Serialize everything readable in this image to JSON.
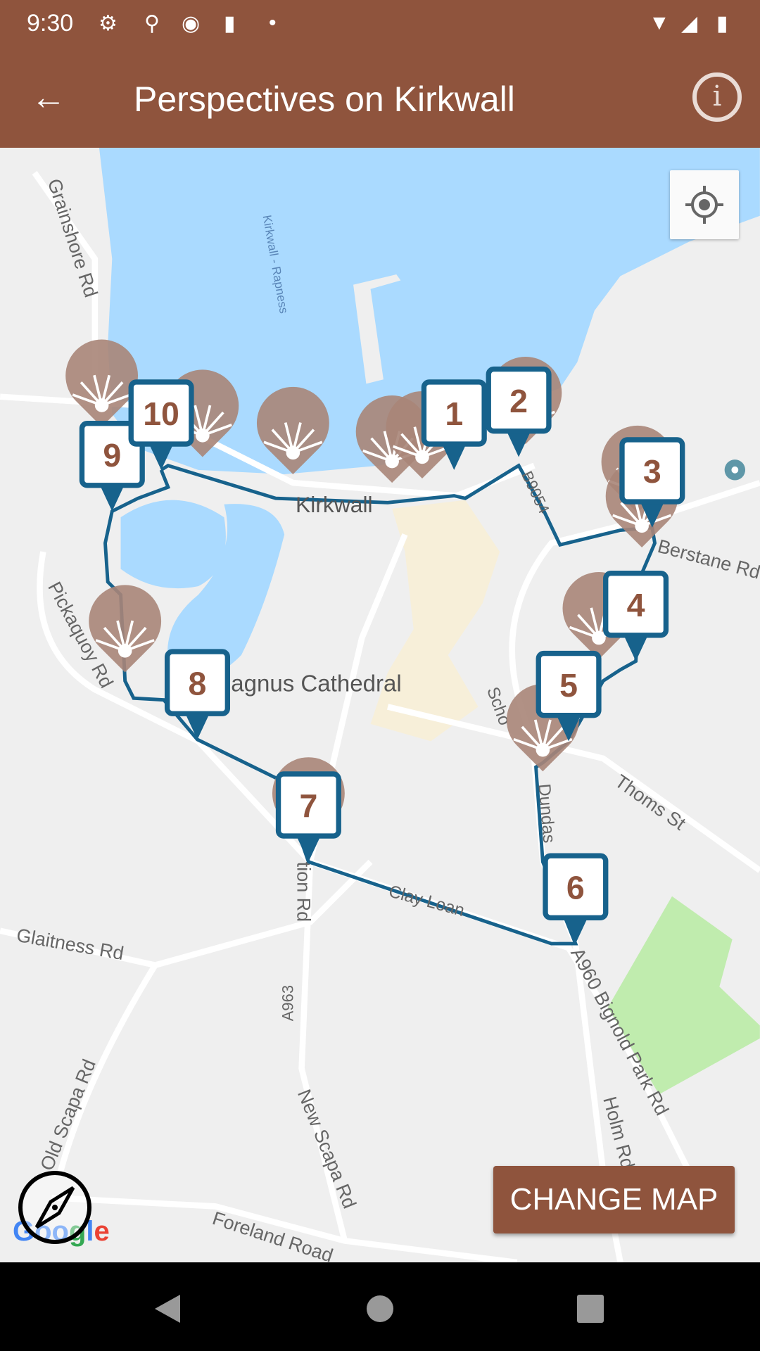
{
  "status_bar": {
    "time": "9:30",
    "icons": [
      "gear-icon",
      "keyhole-icon",
      "location-pin-icon",
      "sd-card-icon",
      "dot-icon",
      "wifi-icon",
      "signal-icon",
      "battery-charging-icon"
    ]
  },
  "app_bar": {
    "title": "Perspectives on Kirkwall",
    "back_icon": "arrow-left-icon",
    "info_icon": "info-icon"
  },
  "map": {
    "labels": {
      "grainshore": "Grainshore Rd",
      "ferry": "Kirkwall - Rapness",
      "kirkwall": "Kirkwall",
      "b9054": "B9054",
      "berstane": "Berstane Rd",
      "pickaquoy": "Pickaquoy Rd",
      "cathedral": "agnus Cathedral",
      "school": "Scho",
      "thoms": "Thoms St",
      "dundas": "Dundas",
      "clay": "Clay Loan",
      "glaitness": "Glaitness Rd",
      "a963": "A963",
      "station": "tion Rd",
      "a960": "A960 Bignold Park Rd",
      "holm": "Holm Rd",
      "oldscapa": "Old Scapa Rd",
      "newscapa": "New Scapa Rd",
      "foreland": "Foreland Road",
      "ar": "Rd"
    },
    "stops": [
      "1",
      "2",
      "3",
      "4",
      "5",
      "6",
      "7",
      "8",
      "9",
      "10"
    ],
    "google_logo": "Google",
    "colors": {
      "route": "#17628c",
      "marker": "#17628c",
      "marker_text": "#8f543d",
      "water": "#aadaff",
      "park": "#c0ecae",
      "shell": "#a98578"
    }
  },
  "change_map_label": "CHANGE MAP"
}
